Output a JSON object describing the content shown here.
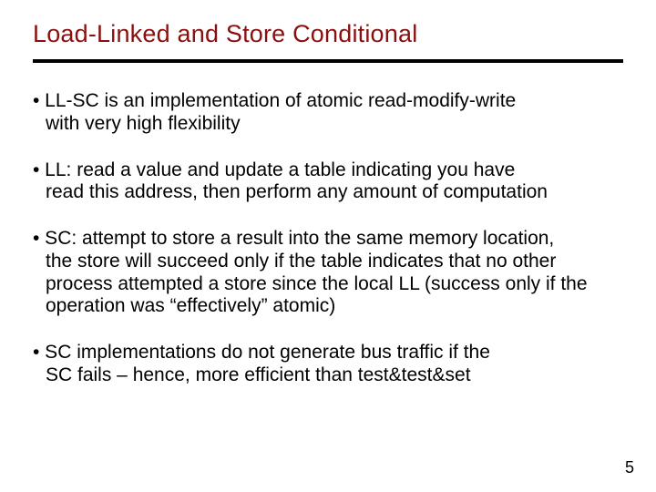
{
  "title": "Load-Linked and Store Conditional",
  "bullets": [
    {
      "first": "• LL-SC is an implementation of atomic read-modify-write",
      "rest": "with very high flexibility"
    },
    {
      "first": "• LL: read a value and update a table indicating you have",
      "rest": "read this address, then perform any amount of computation"
    },
    {
      "first": "• SC: attempt to store a result into the same memory location,",
      "rest": "the store will succeed only if the table indicates that no other process attempted a store since the local LL (success only if the operation was “effectively” atomic)"
    },
    {
      "first": "• SC implementations do not generate bus traffic if the",
      "rest": "SC fails – hence, more efficient than test&test&set"
    }
  ],
  "page_number": "5"
}
